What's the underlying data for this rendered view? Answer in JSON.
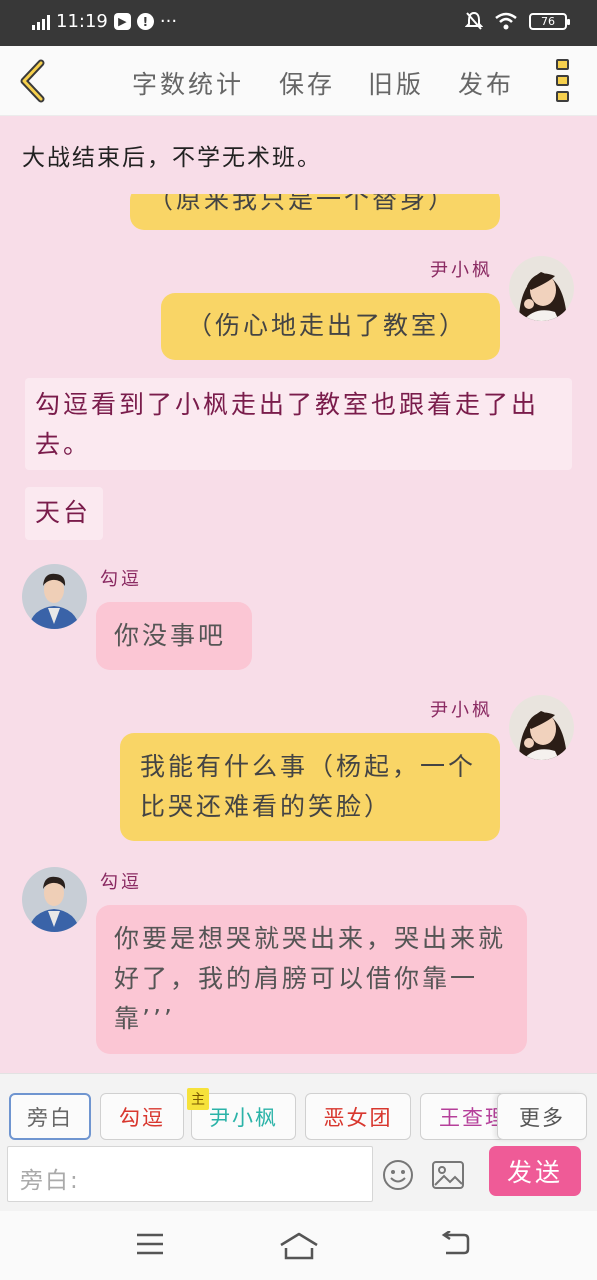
{
  "status": {
    "time": "11:19",
    "battery": "76"
  },
  "toolbar": {
    "word_count": "字数统计",
    "save": "保存",
    "old_version": "旧版",
    "publish": "发布"
  },
  "chat": {
    "header_text": "大战结束后，不学无术班。",
    "messages": [
      {
        "type": "partial_yellow",
        "text": "（原来我只是一个替身）"
      },
      {
        "type": "speaker",
        "name": "尹小枫"
      },
      {
        "type": "yellow",
        "text": "（伤心地走出了教室）"
      },
      {
        "type": "narration",
        "text": "勾逗看到了小枫走出了教室也跟着走了出去。"
      },
      {
        "type": "narration",
        "text": "天台"
      },
      {
        "type": "speaker",
        "name": "勾逗"
      },
      {
        "type": "pink",
        "text": "你没事吧"
      },
      {
        "type": "speaker",
        "name": "尹小枫"
      },
      {
        "type": "yellow",
        "text": "我能有什么事（杨起，一个比哭还难看的笑脸）"
      },
      {
        "type": "speaker",
        "name": "勾逗"
      },
      {
        "type": "pink",
        "text": "你要是想哭就哭出来，哭出来就好了，我的肩膀可以借你靠一靠’’’"
      }
    ]
  },
  "characters": {
    "narrator": "旁白",
    "c1": "勾逗",
    "c2": "尹小枫",
    "c2_tag": "主",
    "c3": "恶女团",
    "c4": "王查理",
    "more": "更多"
  },
  "composer": {
    "placeholder": "旁白:",
    "send": "发送"
  },
  "colors": {
    "accent": "#ef5b97",
    "bubble_self": "#f9d566",
    "bubble_other": "#fbc6d4",
    "background": "#f8dde8"
  }
}
